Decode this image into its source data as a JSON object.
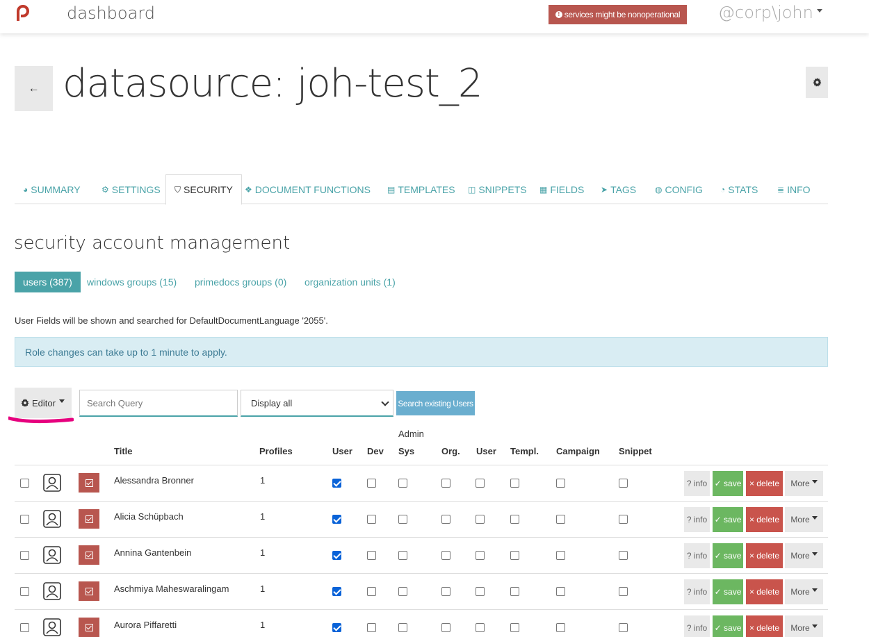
{
  "app": {
    "brand": "dashboard",
    "alert": "services might be nonoperational",
    "user": "@corp\\john"
  },
  "header": {
    "back": "←",
    "title": "datasource: joh-test_2"
  },
  "tabs": [
    {
      "icon": "dashboard-icon",
      "glyph": "◕",
      "label": "SUMMARY"
    },
    {
      "icon": "gear-icon",
      "glyph": "⚙",
      "label": "SETTINGS"
    },
    {
      "icon": "shield-icon",
      "glyph": "⛉",
      "label": "SECURITY"
    },
    {
      "icon": "cubes-icon",
      "glyph": "❖",
      "label": "DOCUMENT FUNCTIONS"
    },
    {
      "icon": "file-text-icon",
      "glyph": "▤",
      "label": "TEMPLATES"
    },
    {
      "icon": "sticky-note-icon",
      "glyph": "◫",
      "label": "SNIPPETS"
    },
    {
      "icon": "list-alt-icon",
      "glyph": "▦",
      "label": "FIELDS"
    },
    {
      "icon": "tags-icon",
      "glyph": "➤",
      "label": "TAGS"
    },
    {
      "icon": "globe-icon",
      "glyph": "◍",
      "label": "CONFIG"
    },
    {
      "icon": "pie-chart-icon",
      "glyph": "◔",
      "label": "STATS"
    },
    {
      "icon": "database-icon",
      "glyph": "≣",
      "label": "INFO"
    }
  ],
  "section": {
    "title": "security account management",
    "subtabs": [
      "users (387)",
      "windows groups (15)",
      "primedocs groups (0)",
      "organization units (1)"
    ],
    "note": "User Fields will be shown and searched for DefaultDocumentLanguage '2055'.",
    "info": "Role changes can take up to 1 minute to apply."
  },
  "toolbar": {
    "editor": "Editor",
    "search_placeholder": "Search Query",
    "display": "Display all",
    "search_button": "Search existing Users"
  },
  "table": {
    "group_header": "Admin",
    "headers": {
      "title": "Title",
      "profiles": "Profiles",
      "user": "User",
      "dev": "Dev",
      "sys": "Sys",
      "org": "Org.",
      "user2": "User",
      "templ": "Templ.",
      "campaign": "Campaign",
      "snippet": "Snippet"
    },
    "actions": {
      "info": "? info",
      "save": "✓ save",
      "delete": "× delete",
      "more": "More"
    },
    "rows": [
      {
        "name": "Alessandra Bronner",
        "profiles": "1"
      },
      {
        "name": "Alicia Schüpbach",
        "profiles": "1"
      },
      {
        "name": "Annina Gantenbein",
        "profiles": "1"
      },
      {
        "name": "Aschmiya Maheswaralingam",
        "profiles": "1"
      },
      {
        "name": "Aurora Piffaretti",
        "profiles": "1"
      }
    ]
  },
  "colors": {
    "accent": "#4aa3a8",
    "danger": "#b8564f",
    "success": "#6cb761",
    "info_bg": "#d9edf3",
    "highlight": "#e6007e"
  }
}
